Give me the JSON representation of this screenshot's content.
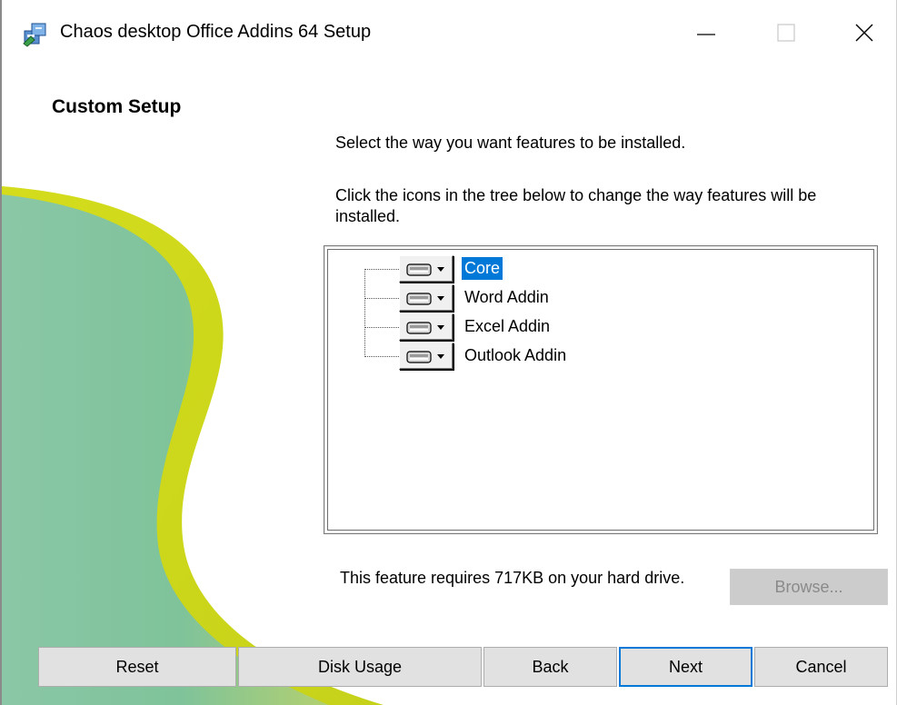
{
  "window": {
    "title": "Chaos desktop Office Addins 64 Setup",
    "icons": {
      "app": "installer-package-icon",
      "minimize": "minimize-icon",
      "maximize": "maximize-icon",
      "close": "close-icon"
    }
  },
  "heading": "Custom Setup",
  "instructions": {
    "line1": "Select the way you want features to be installed.",
    "line2": "Click the icons in the tree below to change the way features will be installed."
  },
  "feature_tree": {
    "items": [
      {
        "label": "Core",
        "selected": true,
        "icon": "drive-install-dropdown-icon"
      },
      {
        "label": "Word Addin",
        "selected": false,
        "icon": "drive-install-dropdown-icon"
      },
      {
        "label": "Excel Addin",
        "selected": false,
        "icon": "drive-install-dropdown-icon"
      },
      {
        "label": "Outlook Addin",
        "selected": false,
        "icon": "drive-install-dropdown-icon"
      }
    ]
  },
  "feature_info": "This feature requires 717KB on your hard drive.",
  "buttons": {
    "browse": "Browse...",
    "reset": "Reset",
    "disk_usage": "Disk Usage",
    "back": "Back",
    "next": "Next",
    "cancel": "Cancel"
  },
  "colors": {
    "selection": "#0078d7",
    "art_yellow": "#c7d418",
    "art_green": "#7ec7a0"
  }
}
